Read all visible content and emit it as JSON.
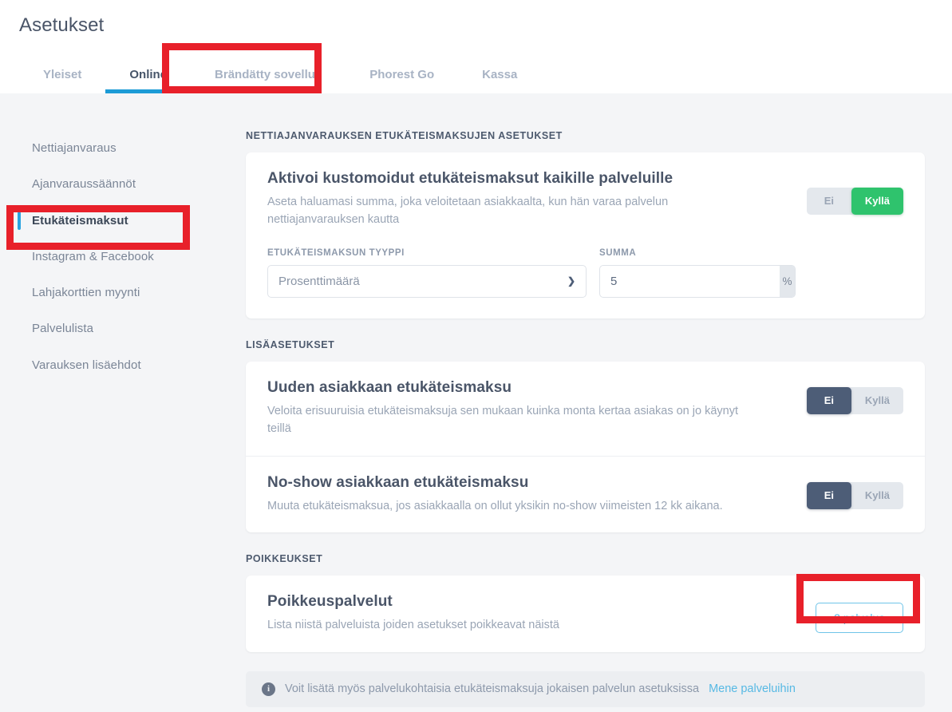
{
  "header": {
    "title": "Asetukset",
    "tabs": [
      {
        "label": "Yleiset",
        "active": false
      },
      {
        "label": "Online",
        "active": true
      },
      {
        "label": "Brändätty sovellus",
        "active": false
      },
      {
        "label": "Phorest Go",
        "active": false
      },
      {
        "label": "Kassa",
        "active": false
      }
    ]
  },
  "sidebar": {
    "items": [
      {
        "label": "Nettiajanvaraus"
      },
      {
        "label": "Ajanvaraussäännöt"
      },
      {
        "label": "Etukäteismaksut"
      },
      {
        "label": "Instagram & Facebook"
      },
      {
        "label": "Lahjakorttien myynti"
      },
      {
        "label": "Palvelulista"
      },
      {
        "label": "Varauksen lisäehdot"
      }
    ]
  },
  "main": {
    "section_online": {
      "label": "NETTIAJANVARAUKSEN ETUKÄTEISMAKSUJEN ASETUKSET",
      "row": {
        "title": "Aktivoi kustomoidut etukäteismaksut kaikille palveluille",
        "desc": "Aseta haluamasi summa, joka veloitetaan asiakkaalta, kun hän varaa palvelun nettiajanvarauksen kautta",
        "toggle": {
          "no": "Ei",
          "yes": "Kyllä",
          "selected": "yes"
        }
      },
      "fields": {
        "type_label": "ETUKÄTEISMAKSUN TYYPPI",
        "type_value": "Prosenttimäärä",
        "amount_label": "SUMMA",
        "amount_value": "5",
        "amount_suffix": "%"
      }
    },
    "section_extra": {
      "label": "LISÄASETUKSET",
      "rows": [
        {
          "title": "Uuden asiakkaan etukäteismaksu",
          "desc": "Veloita erisuuruisia etukäteismaksuja sen mukaan kuinka monta kertaa asiakas on jo käynyt teillä",
          "toggle": {
            "no": "Ei",
            "yes": "Kyllä",
            "selected": "no"
          }
        },
        {
          "title": "No-show asiakkaan etukäteismaksu",
          "desc": "Muuta etukäteismaksua, jos asiakkaalla on ollut yksikin no-show viimeisten 12 kk aikana.",
          "toggle": {
            "no": "Ei",
            "yes": "Kyllä",
            "selected": "no"
          }
        }
      ]
    },
    "section_exceptions": {
      "label": "POIKKEUKSET",
      "row": {
        "title": "Poikkeuspalvelut",
        "desc": "Lista niistä palveluista joiden asetukset poikkeavat näistä",
        "button": "2 palvelua"
      }
    },
    "info": {
      "icon": "info-icon",
      "text": "Voit lisätä myös palvelukohtaisia etukäteismaksuja jokaisen palvelun asetuksissa",
      "link": "Mene palveluihin"
    }
  },
  "colors": {
    "accent": "#1c9bd6",
    "toggle_yes": "#2fc36d",
    "toggle_no": "#4d5d77",
    "link": "#57b9e4",
    "annotation": "#e8202a",
    "page_bg": "#f4f5f7"
  },
  "annotations": {
    "highlight_tab": "Online",
    "highlight_sidebar": "Etukäteismaksut",
    "highlight_button": "2 palvelua"
  }
}
